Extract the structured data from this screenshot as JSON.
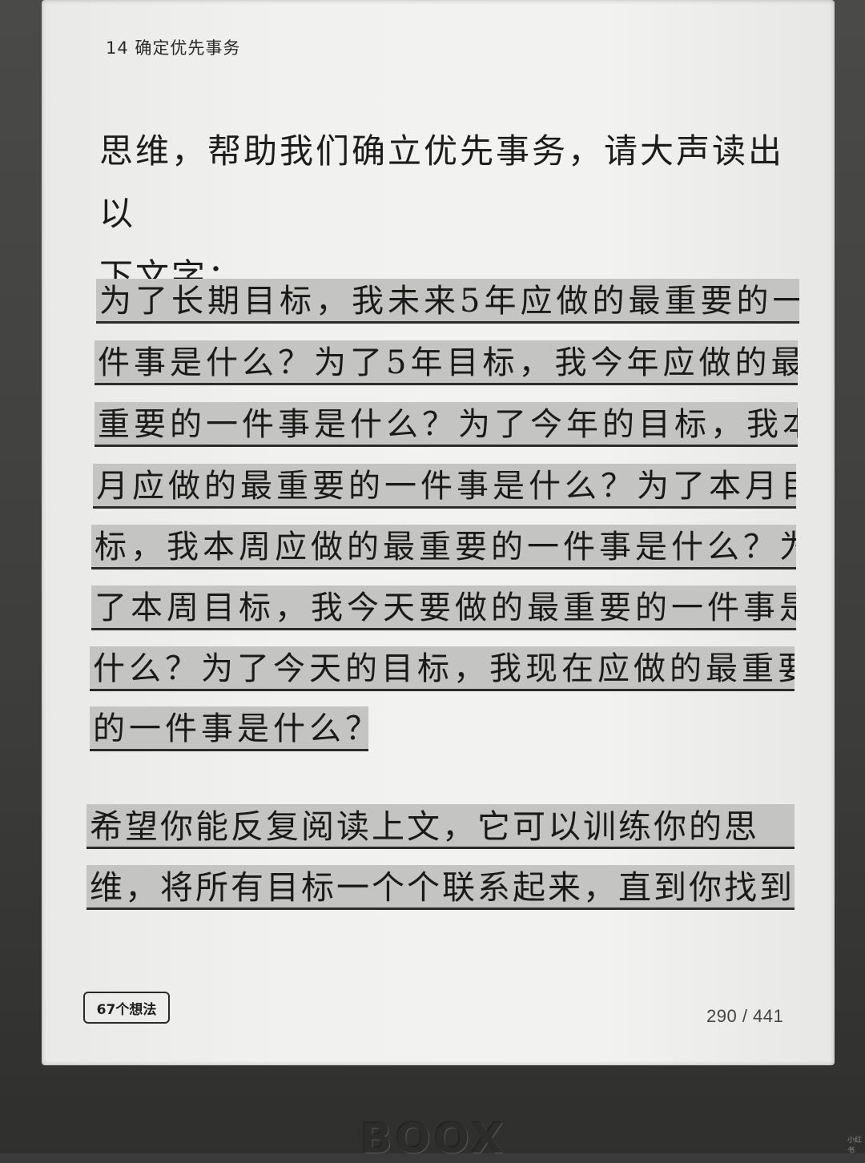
{
  "reader": {
    "chapter_title": "14 确定优先事务",
    "intro_lines": [
      "思维，帮助我们确立优先事务，请大声读出以",
      "下文字："
    ],
    "quote_lines": [
      "为了长期目标，我未来5年应做的最重要的一",
      "件事是什么？为了5年目标，我今年应做的最",
      "重要的一件事是什么？为了今年的目标，我本",
      "月应做的最重要的一件事是什么？为了本月目",
      "标，我本周应做的最重要的一件事是什么？为",
      "了本周目标，我今天要做的最重要的一件事是",
      "什么？为了今天的目标，我现在应做的最重要",
      "的一件事是什么？"
    ],
    "closing_lines": [
      "希望你能反复阅读上文，它可以训练你的思",
      "维，将所有目标一个个联系起来，直到你找到"
    ],
    "ideas_button_label": "67个想法",
    "page_indicator": "290 / 441"
  },
  "device": {
    "brand": "BOOX",
    "watermark": "小红书"
  },
  "colors": {
    "highlight_bg": "#c4c4c3",
    "screen_bg": "#f1f1ef",
    "bezel": "#3d3d3b"
  }
}
